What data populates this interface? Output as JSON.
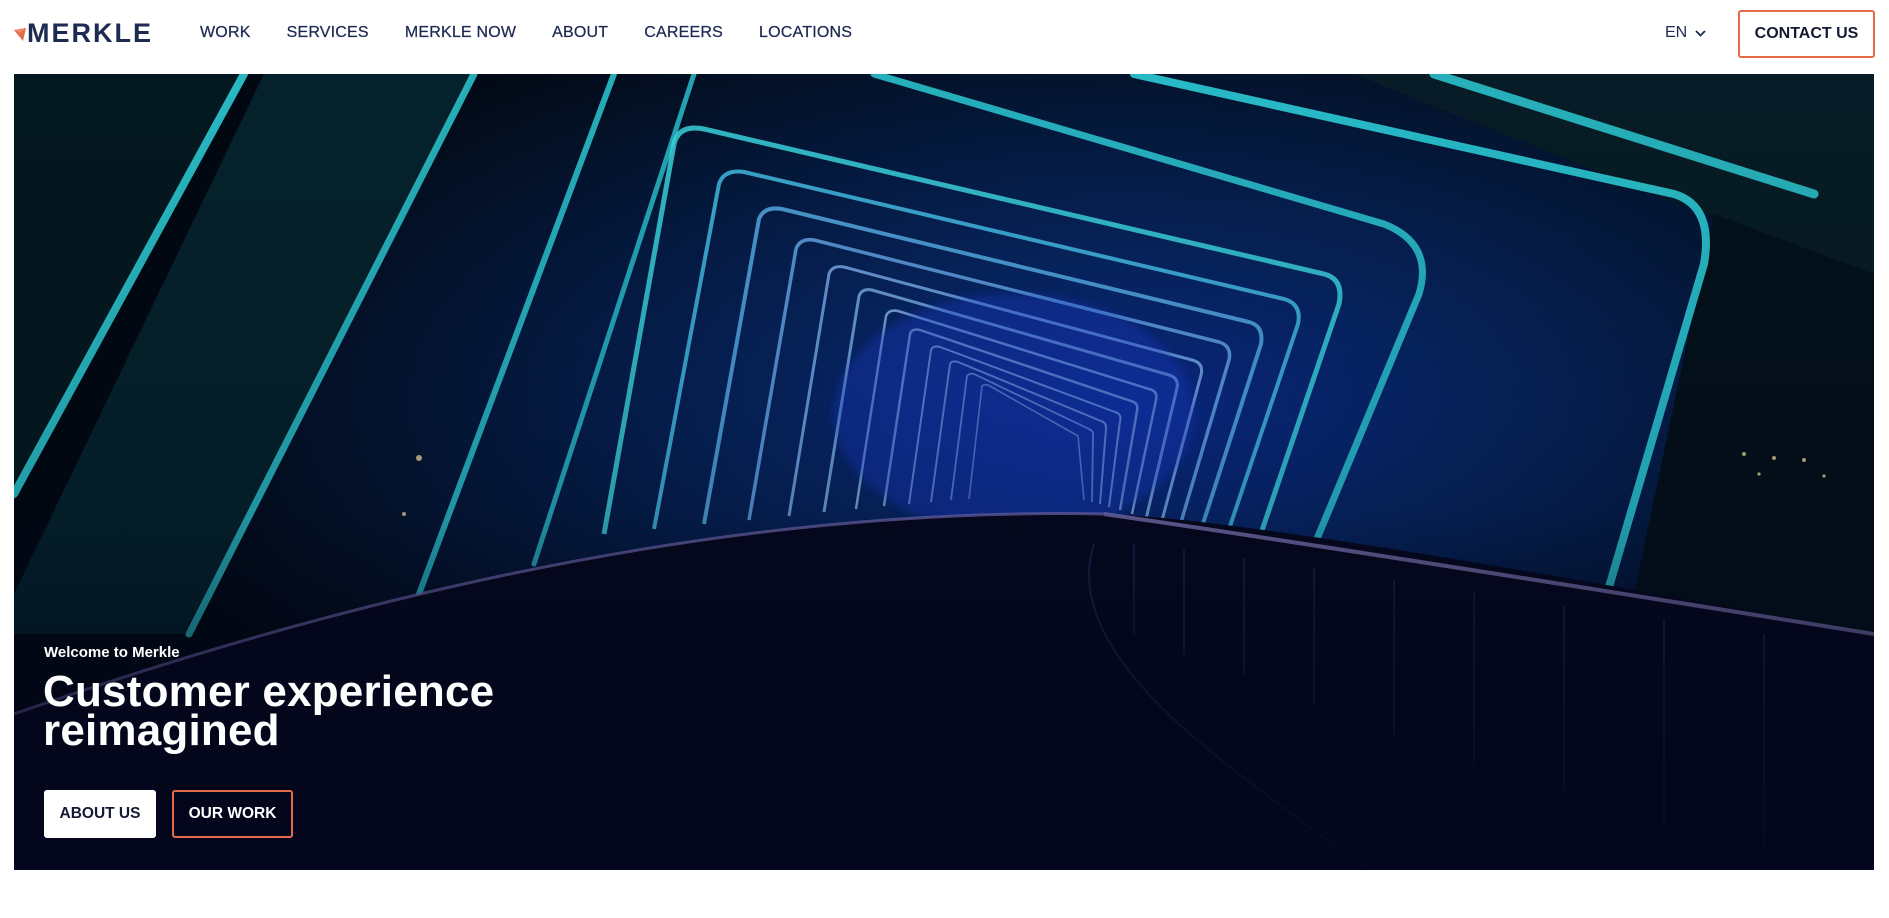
{
  "brand": {
    "name": "MERKLE",
    "accent_color": "#e46a4a",
    "navy_color": "#1d2a52"
  },
  "nav": {
    "items": [
      {
        "label": "WORK"
      },
      {
        "label": "SERVICES"
      },
      {
        "label": "MERKLE NOW"
      },
      {
        "label": "ABOUT"
      },
      {
        "label": "CAREERS"
      },
      {
        "label": "LOCATIONS"
      }
    ]
  },
  "language": {
    "selected": "EN",
    "icon": "chevron-down-icon"
  },
  "contact": {
    "label": "CONTACT US"
  },
  "hero": {
    "eyebrow": "Welcome to Merkle",
    "title": "Customer experience reimagined",
    "image": "illuminated-bridge-tunnel",
    "buttons": {
      "about": "ABOUT US",
      "work": "OUR WORK"
    }
  }
}
